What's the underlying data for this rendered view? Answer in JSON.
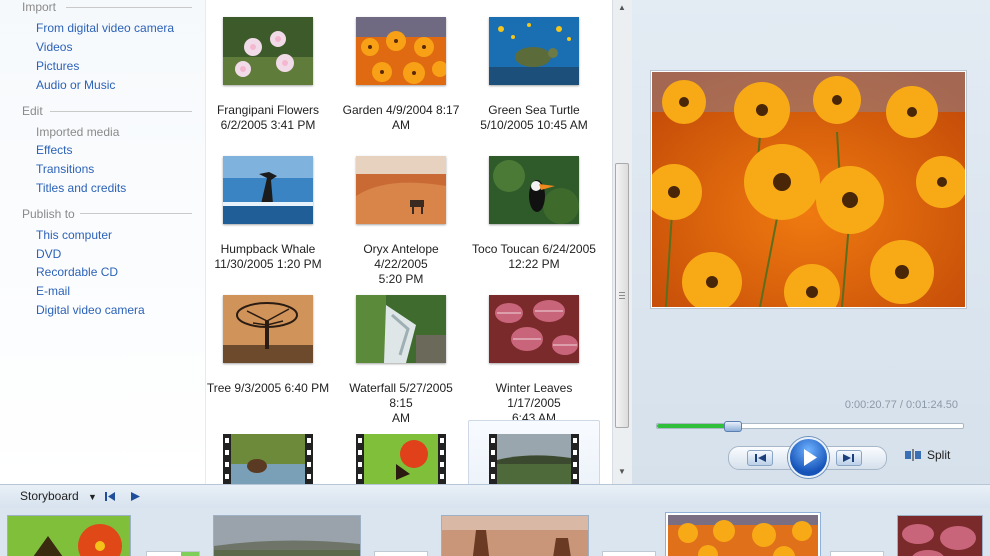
{
  "tasks": {
    "import": {
      "header": "Import",
      "items": [
        "From digital video camera",
        "Videos",
        "Pictures",
        "Audio or Music"
      ]
    },
    "edit": {
      "header": "Edit",
      "items": [
        "Imported media",
        "Effects",
        "Transitions",
        "Titles and credits"
      ]
    },
    "publish": {
      "header": "Publish to",
      "items": [
        "This computer",
        "DVD",
        "Recordable CD",
        "E-mail",
        "Digital video camera"
      ]
    }
  },
  "collection": {
    "items": [
      {
        "line1": "Frangipani Flowers",
        "line2": "6/2/2005 3:41 PM"
      },
      {
        "line1": "Garden 4/9/2004 8:17",
        "line2": "AM"
      },
      {
        "line1": "Green Sea Turtle",
        "line2": "5/10/2005 10:45 AM"
      },
      {
        "line1": "Humpback Whale",
        "line2": "11/30/2005 1:20 PM"
      },
      {
        "line1": "Oryx Antelope 4/22/2005",
        "line2": "5:20 PM"
      },
      {
        "line1": "Toco Toucan 6/24/2005",
        "line2": "12:22 PM"
      },
      {
        "line1": "Tree 9/3/2005 6:40 PM",
        "line2": ""
      },
      {
        "line1": "Waterfall 5/27/2005 8:15",
        "line2": "AM"
      },
      {
        "line1": "Winter Leaves 1/17/2005",
        "line2": "6:43 AM"
      }
    ],
    "video_clips": [
      "bear-clip-icon",
      "butterfly-clip-icon",
      "landscape-clip-icon"
    ]
  },
  "preview": {
    "timecode": "0:00:20.77 / 0:01:24.50",
    "progress": 0.246,
    "split_label": "Split"
  },
  "storyboard": {
    "label": "Storyboard"
  },
  "colors": {
    "link": "#2c62b8",
    "seek_fill": "#2fbf3b",
    "play_button": "#1553b8"
  }
}
